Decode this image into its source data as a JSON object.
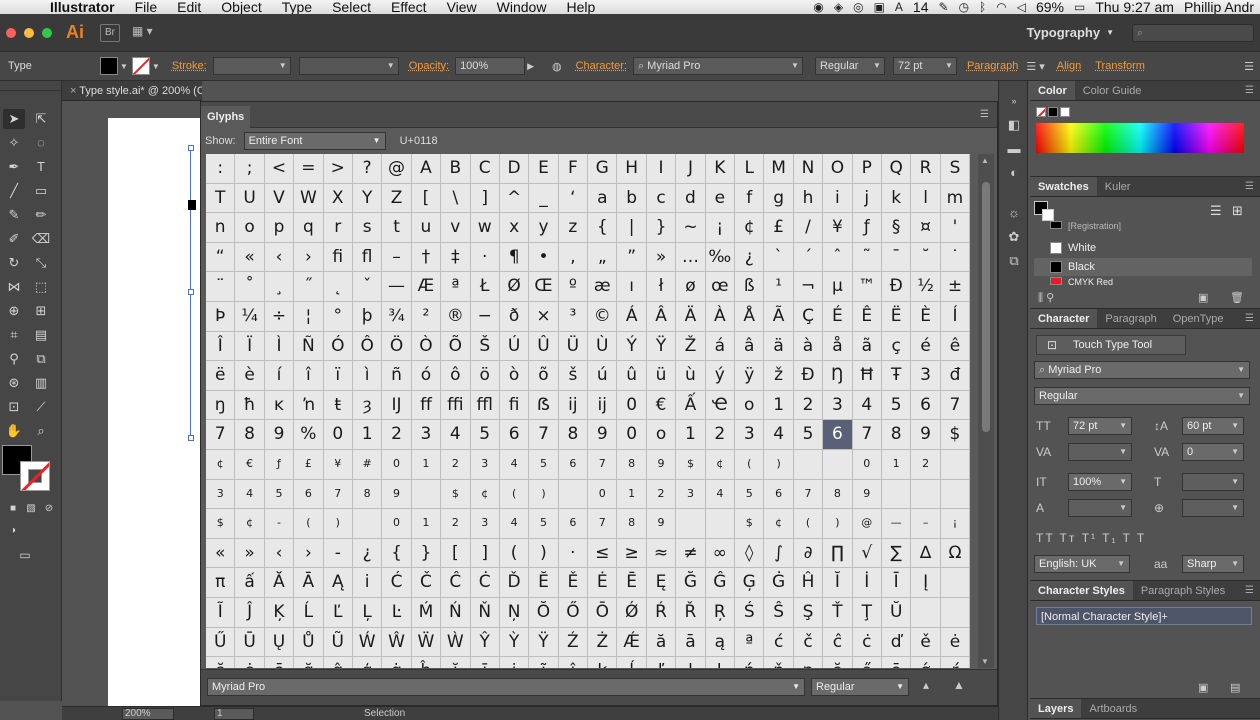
{
  "menubar": {
    "app": "Illustrator",
    "items": [
      "File",
      "Edit",
      "Object",
      "Type",
      "Select",
      "Effect",
      "View",
      "Window",
      "Help"
    ],
    "status_number": "14",
    "battery": "69%",
    "clock": "Thu 9:27 am",
    "user": "Phillip Andr"
  },
  "appbar": {
    "logo": "Ai",
    "bridge_label": "Br",
    "workspace": "Typography",
    "traffic_colors": [
      "#fc605c",
      "#fdbc40",
      "#34c84a"
    ]
  },
  "control": {
    "mode": "Type",
    "stroke_label": "Stroke:",
    "opacity_label": "Opacity:",
    "opacity_value": "100%",
    "character_label": "Character:",
    "font": "Myriad Pro",
    "style": "Regular",
    "size": "72 pt",
    "paragraph_label": "Paragraph",
    "align_label": "Align",
    "transform_label": "Transform"
  },
  "document": {
    "tab": "Type style.ai* @ 200% (CMYK/Preview)"
  },
  "glyphs": {
    "title": "Glyphs",
    "show_label": "Show:",
    "show_value": "Entire Font",
    "unicode": "U+0118",
    "rows": [
      [
        ":",
        ";",
        "<",
        "=",
        ">",
        "?",
        "@",
        "A",
        "B",
        "C",
        "D",
        "E",
        "F",
        "G",
        "H",
        "I",
        "J",
        "K",
        "L",
        "M",
        "N",
        "O",
        "P",
        "Q",
        "R",
        "S"
      ],
      [
        "T",
        "U",
        "V",
        "W",
        "X",
        "Y",
        "Z",
        "[",
        "\\",
        "]",
        "^",
        "_",
        "‘",
        "a",
        "b",
        "c",
        "d",
        "e",
        "f",
        "g",
        "h",
        "i",
        "j",
        "k",
        "l",
        "m"
      ],
      [
        "n",
        "o",
        "p",
        "q",
        "r",
        "s",
        "t",
        "u",
        "v",
        "w",
        "x",
        "y",
        "z",
        "{",
        "|",
        "}",
        "~",
        "¡",
        "¢",
        "£",
        "/",
        "¥",
        "ƒ",
        "§",
        "¤",
        "'"
      ],
      [
        "“",
        "«",
        "‹",
        "›",
        "ﬁ",
        "ﬂ",
        "–",
        "†",
        "‡",
        "·",
        "¶",
        "•",
        "‚",
        "„",
        "”",
        "»",
        "…",
        "‰",
        "¿",
        "`",
        "´",
        "ˆ",
        "˜",
        "¯",
        "˘",
        "˙"
      ],
      [
        "¨",
        "˚",
        "¸",
        "˝",
        "˛",
        "ˇ",
        "—",
        "Æ",
        "ª",
        "Ł",
        "Ø",
        "Œ",
        "º",
        "æ",
        "ı",
        "ł",
        "ø",
        "œ",
        "ß",
        "¹",
        "¬",
        "µ",
        "™",
        "Ð",
        "½",
        "±"
      ],
      [
        "Þ",
        "¼",
        "÷",
        "¦",
        "°",
        "þ",
        "¾",
        "²",
        "®",
        "−",
        "ð",
        "×",
        "³",
        "©",
        "Á",
        "Â",
        "Ä",
        "À",
        "Å",
        "Ã",
        "Ç",
        "É",
        "Ê",
        "Ë",
        "È",
        "Í"
      ],
      [
        "Î",
        "Ï",
        "Ì",
        "Ñ",
        "Ó",
        "Ô",
        "Ö",
        "Ò",
        "Õ",
        "Š",
        "Ú",
        "Û",
        "Ü",
        "Ù",
        "Ý",
        "Ÿ",
        "Ž",
        "á",
        "â",
        "ä",
        "à",
        "å",
        "ã",
        "ç",
        "é",
        "ê"
      ],
      [
        "ë",
        "è",
        "í",
        "î",
        "ï",
        "ì",
        "ñ",
        "ó",
        "ô",
        "ö",
        "ò",
        "õ",
        "š",
        "ú",
        "û",
        "ü",
        "ù",
        "ý",
        "ÿ",
        "ž",
        "Đ",
        "Ŋ",
        "Ħ",
        "Ŧ",
        "3",
        "đ"
      ],
      [
        "ŋ",
        "ħ",
        "ĸ",
        "ŉ",
        "ŧ",
        "ȝ",
        "Ĳ",
        "ﬀ",
        "ﬃ",
        "ﬄ",
        "ﬁ",
        "ẞ",
        "ĳ",
        "ĳ",
        "0",
        "€",
        "Ấ",
        "Ҽ",
        "o",
        "1",
        "2",
        "3",
        "4",
        "5",
        "6",
        "7"
      ],
      [
        "7",
        "8",
        "9",
        "%",
        "0",
        "1",
        "2",
        "3",
        "4",
        "5",
        "6",
        "7",
        "8",
        "9",
        "0",
        "o",
        "1",
        "2",
        "3",
        "4",
        "5",
        "6",
        "7",
        "8",
        "9",
        "$"
      ],
      [
        "¢",
        "€",
        "ƒ",
        "£",
        "¥",
        "#",
        "0",
        "1",
        "2",
        "3",
        "4",
        "5",
        "6",
        "7",
        "8",
        "9",
        "$",
        "¢",
        "(",
        ")",
        "",
        "",
        "0",
        "1",
        "2",
        ""
      ],
      [
        "3",
        "4",
        "5",
        "6",
        "7",
        "8",
        "9",
        "",
        "$",
        "¢",
        "(",
        ")",
        "",
        "0",
        "1",
        "2",
        "3",
        "4",
        "5",
        "6",
        "7",
        "8",
        "9",
        "",
        "",
        ""
      ],
      [
        "$",
        "¢",
        "-",
        "(",
        ")",
        "",
        "0",
        "1",
        "2",
        "3",
        "4",
        "5",
        "6",
        "7",
        "8",
        "9",
        "",
        "",
        "$",
        "¢",
        "(",
        ")",
        "@",
        "—",
        "–",
        "¡"
      ],
      [
        "«",
        "»",
        "‹",
        "›",
        "-",
        "¿",
        "{",
        "}",
        "[",
        "]",
        "(",
        ")",
        "·",
        "≤",
        "≥",
        "≈",
        "≠",
        "∞",
        "◊",
        "∫",
        "∂",
        "∏",
        "√",
        "∑",
        "∆",
        "Ω"
      ],
      [
        "π",
        "ấ",
        "Ă",
        "Ā",
        "Ą",
        "i",
        "Ć",
        "Č",
        "Ĉ",
        "Ċ",
        "Ď",
        "Ĕ",
        "Ě",
        "Ė",
        "Ē",
        "Ę",
        "Ğ",
        "Ĝ",
        "Ģ",
        "Ġ",
        "Ĥ",
        "Ĭ",
        "İ",
        "Ī",
        "Į",
        ""
      ],
      [
        "Ĩ",
        "Ĵ",
        "Ķ",
        "Ĺ",
        "Ľ",
        "Ļ",
        "Ŀ",
        "Ḿ",
        "Ń",
        "Ň",
        "Ņ",
        "Ŏ",
        "Ő",
        "Ō",
        "Ǿ",
        "Ŕ",
        "Ř",
        "Ŗ",
        "Ś",
        "Ŝ",
        "Ş",
        "Ť",
        "Ţ",
        "Ŭ",
        "",
        ""
      ],
      [
        "Ű",
        "Ū",
        "Ų",
        "Ů",
        "Ũ",
        "Ẃ",
        "Ŵ",
        "Ẅ",
        "Ẁ",
        "Ŷ",
        "Ỳ",
        "Ÿ",
        "Ź",
        "Ż",
        "Ǽ",
        "ă",
        "ā",
        "ą",
        "ª",
        "ć",
        "č",
        "ĉ",
        "ċ",
        "ď",
        "ě",
        "ė"
      ],
      [
        "ĕ",
        "ė",
        "ē",
        "ğ",
        "ĝ",
        "ģ",
        "ġ",
        "ĥ",
        "ĭ",
        "ī",
        "į",
        "ĩ",
        "ĵ",
        "ķ",
        "ĺ",
        "ľ",
        "ļ",
        "ŀ",
        "ń",
        "ň",
        "ņ",
        "ŏ",
        "ő",
        "ō",
        "ǿ",
        "ŕ"
      ]
    ],
    "font": "Myriad Pro",
    "style": "Regular"
  },
  "panels": {
    "color_tab": "Color",
    "color_guide_tab": "Color Guide",
    "swatches_tab": "Swatches",
    "kuler_tab": "Kuler",
    "swatches": [
      {
        "name": "[Registration]",
        "color": "#000000"
      },
      {
        "name": "White",
        "color": "#ffffff"
      },
      {
        "name": "Black",
        "color": "#000000"
      },
      {
        "name": "CMYK Red",
        "color": "#ed1c24"
      }
    ],
    "character_tab": "Character",
    "paragraph_tab": "Paragraph",
    "opentype_tab": "OpenType",
    "touch_type": "Touch Type Tool",
    "font": "Myriad Pro",
    "style": "Regular",
    "size": "72 pt",
    "leading": "60 pt",
    "tracking": "0",
    "scale": "100%",
    "language": "English: UK",
    "aa_label": "aa",
    "antialias": "Sharp",
    "char_styles_tab": "Character Styles",
    "para_styles_tab": "Paragraph Styles",
    "style_item": "[Normal Character Style]+",
    "layers_tab": "Layers",
    "artboards_tab": "Artboards"
  },
  "status": {
    "zoom": "200%",
    "page": "1",
    "mode": "Selection"
  }
}
